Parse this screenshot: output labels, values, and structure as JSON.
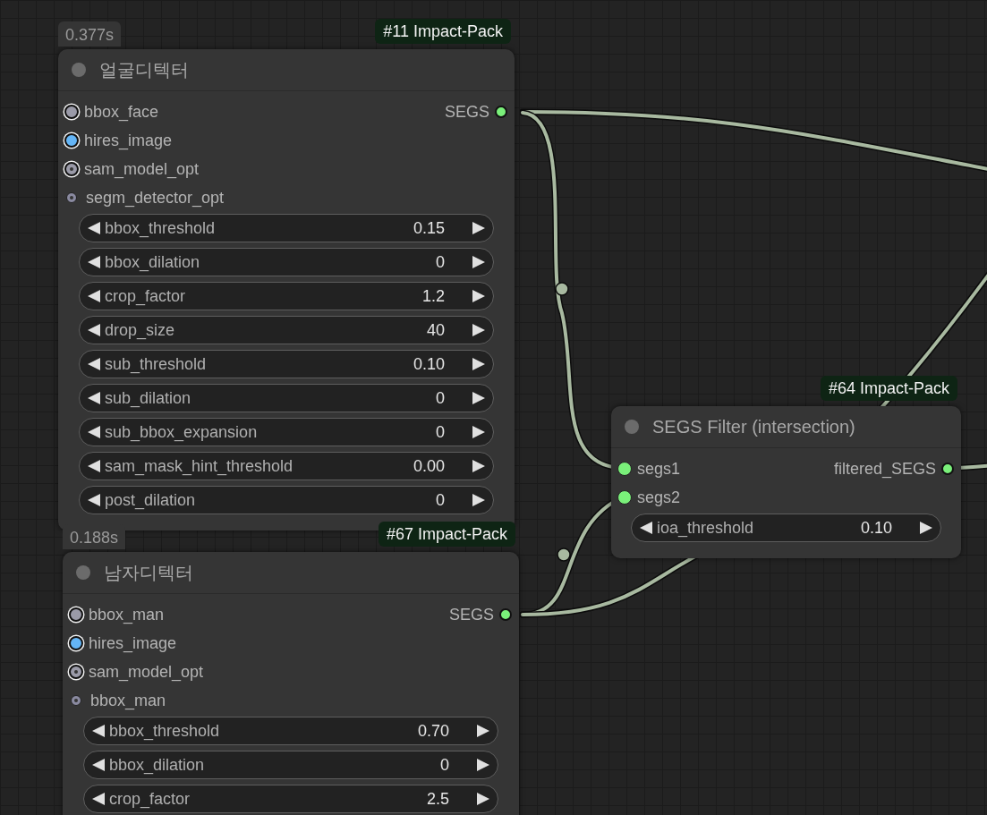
{
  "nodes": [
    {
      "time": "0.377s",
      "badge": "#11 Impact-Pack",
      "title": "얼굴디텍터",
      "inputs": [
        {
          "label": "bbox_face",
          "color": "#9a9aa8",
          "ringed": true,
          "optional": false
        },
        {
          "label": "hires_image",
          "color": "#64b5f6",
          "ringed": true,
          "optional": false
        },
        {
          "label": "sam_model_opt",
          "color": "#9a9aa8",
          "ringed": true,
          "optional": true
        },
        {
          "label": "segm_detector_opt",
          "color": "#8a8aa0",
          "ringed": false,
          "optional": true
        }
      ],
      "outputs": [
        {
          "label": "SEGS",
          "color": "#7af07a"
        }
      ],
      "widgets": [
        {
          "label": "bbox_threshold",
          "value": "0.15"
        },
        {
          "label": "bbox_dilation",
          "value": "0"
        },
        {
          "label": "crop_factor",
          "value": "1.2"
        },
        {
          "label": "drop_size",
          "value": "40"
        },
        {
          "label": "sub_threshold",
          "value": "0.10"
        },
        {
          "label": "sub_dilation",
          "value": "0"
        },
        {
          "label": "sub_bbox_expansion",
          "value": "0"
        },
        {
          "label": "sam_mask_hint_threshold",
          "value": "0.00"
        },
        {
          "label": "post_dilation",
          "value": "0"
        }
      ]
    },
    {
      "time": "0.188s",
      "badge": "#67 Impact-Pack",
      "title": "남자디텍터",
      "inputs": [
        {
          "label": "bbox_man",
          "color": "#9a9aa8",
          "ringed": true,
          "optional": false
        },
        {
          "label": "hires_image",
          "color": "#64b5f6",
          "ringed": true,
          "optional": false
        },
        {
          "label": "sam_model_opt",
          "color": "#9a9aa8",
          "ringed": true,
          "optional": true
        },
        {
          "label": "bbox_man",
          "color": "#8a8aa0",
          "ringed": false,
          "optional": true
        }
      ],
      "outputs": [
        {
          "label": "SEGS",
          "color": "#7af07a"
        }
      ],
      "widgets": [
        {
          "label": "bbox_threshold",
          "value": "0.70"
        },
        {
          "label": "bbox_dilation",
          "value": "0"
        },
        {
          "label": "crop_factor",
          "value": "2.5"
        }
      ]
    },
    {
      "badge": "#64 Impact-Pack",
      "title": "SEGS Filter (intersection)",
      "inputs": [
        {
          "label": "segs1",
          "color": "#7af07a",
          "ringed": false,
          "optional": false
        },
        {
          "label": "segs2",
          "color": "#7af07a",
          "ringed": false,
          "optional": false
        }
      ],
      "outputs": [
        {
          "label": "filtered_SEGS",
          "color": "#7af07a"
        }
      ],
      "widgets": [
        {
          "label": "ioa_threshold",
          "value": "0.10"
        }
      ]
    }
  ]
}
